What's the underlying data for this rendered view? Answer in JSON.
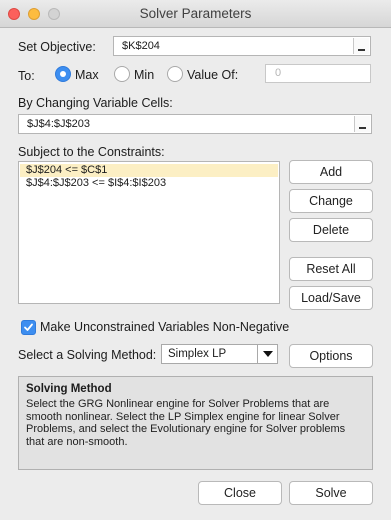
{
  "window": {
    "title": "Solver Parameters"
  },
  "objective": {
    "label": "Set Objective:",
    "value": "$K$204"
  },
  "to": {
    "label": "To:",
    "options": [
      "Max",
      "Min",
      "Value Of:"
    ],
    "selected": "Max",
    "value_of": "0"
  },
  "variable_cells": {
    "label": "By Changing Variable Cells:",
    "value": "$J$4:$J$203"
  },
  "constraints": {
    "label": "Subject to the Constraints:",
    "items": [
      "$J$204 <= $C$1",
      "$J$4:$J$203 <= $I$4:$I$203"
    ],
    "selected_index": 0
  },
  "constraint_buttons": {
    "add": "Add",
    "change": "Change",
    "delete": "Delete",
    "reset_all": "Reset All",
    "load_save": "Load/Save"
  },
  "nonnegative": {
    "label": "Make Unconstrained Variables Non-Negative",
    "checked": true
  },
  "solving_method": {
    "label": "Select a Solving Method:",
    "selected": "Simplex LP",
    "options_button": "Options"
  },
  "method_info": {
    "heading": "Solving Method",
    "body": "Select the GRG Nonlinear engine for Solver Problems that are smooth nonlinear. Select the LP Simplex engine for linear Solver Problems, and select the Evolutionary engine for Solver problems that are non-smooth."
  },
  "footer": {
    "close": "Close",
    "solve": "Solve"
  },
  "colors": {
    "accent": "#3d8ef0",
    "selected_row": "#fcefc4",
    "window_bg": "#ececec"
  },
  "icons": [
    "close-window-icon",
    "minimize-window-icon",
    "zoom-window-icon",
    "collapse-dialog-icon",
    "checkmark-icon",
    "chevron-down-icon"
  ]
}
